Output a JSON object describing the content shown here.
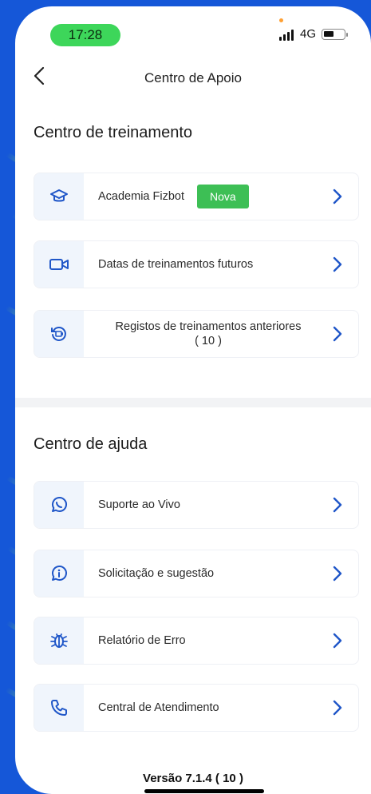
{
  "status_bar": {
    "time": "17:28",
    "network": "4G"
  },
  "header": {
    "title": "Centro de Apoio"
  },
  "training": {
    "title": "Centro de treinamento",
    "items": [
      {
        "label": "Academia Fizbot",
        "badge": "Nova",
        "icon": "graduation-cap-icon"
      },
      {
        "label": "Datas de treinamentos futuros",
        "icon": "video-camera-icon"
      },
      {
        "label": "Registos de treinamentos anteriores",
        "label2": "( 10 )",
        "icon": "history-play-icon"
      }
    ]
  },
  "help": {
    "title": "Centro de ajuda",
    "items": [
      {
        "label": "Suporte ao Vivo",
        "icon": "whatsapp-icon"
      },
      {
        "label": "Solicitação e sugestão",
        "icon": "info-icon"
      },
      {
        "label": "Relatório de Erro",
        "icon": "bug-icon"
      },
      {
        "label": "Central de Atendimento",
        "icon": "phone-icon"
      }
    ]
  },
  "footer": {
    "version": "Versão 7.1.4 ( 10 )"
  },
  "colors": {
    "background": "#1557d8",
    "accent": "#1f56c8",
    "badge": "#3dbf55",
    "time_pill": "#3dd65a"
  }
}
